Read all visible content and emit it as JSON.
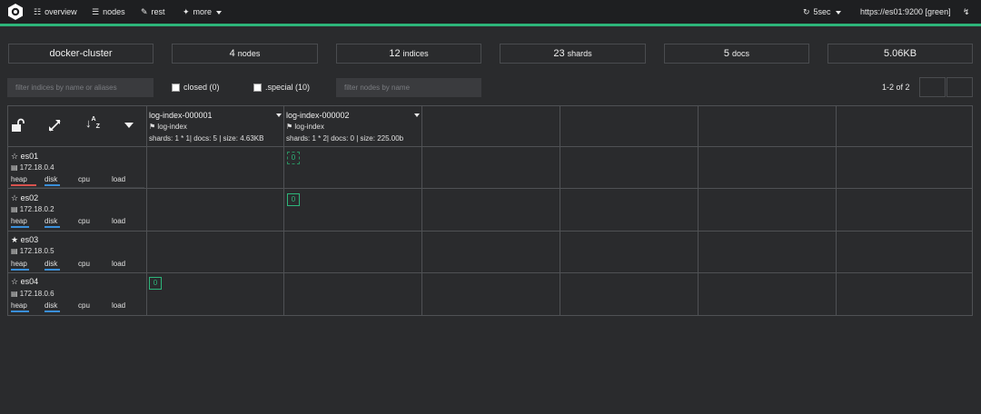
{
  "navbar": {
    "overview": "overview",
    "nodes": "nodes",
    "rest": "rest",
    "more": "more",
    "refresh": "5sec",
    "cluster_url": "https://es01:9200 [green]",
    "accent_color": "#2db57a"
  },
  "stats": {
    "cluster_name": "docker-cluster",
    "nodes_count": "4",
    "nodes_unit": "nodes",
    "indices_count": "12",
    "indices_unit": "indices",
    "shards_count": "23",
    "shards_unit": "shards",
    "docs_count": "5",
    "docs_unit": "docs",
    "size": "5.06KB"
  },
  "filters": {
    "indices_placeholder": "filter indices by name or aliases",
    "closed_label": "closed (0)",
    "special_label": ".special (10)",
    "nodes_placeholder": "filter nodes by name",
    "pagination": "1-2 of 2"
  },
  "indices": [
    {
      "name": "log-index-000001",
      "alias": "log-index",
      "stats": "shards: 1 * 1| docs: 5 | size: 4.63KB"
    },
    {
      "name": "log-index-000002",
      "alias": "log-index",
      "stats": "shards: 1 * 2| docs: 0 | size: 225.00b"
    }
  ],
  "nodes": [
    {
      "name": "es01",
      "ip": "172.18.0.4",
      "master": false,
      "heap_color": "#d9534f",
      "disk_color": "#3a8fd9"
    },
    {
      "name": "es02",
      "ip": "172.18.0.2",
      "master": false,
      "heap_color": "#3a8fd9",
      "disk_color": "#3a8fd9"
    },
    {
      "name": "es03",
      "ip": "172.18.0.5",
      "master": true,
      "heap_color": "#3a8fd9",
      "disk_color": "#3a8fd9"
    },
    {
      "name": "es04",
      "ip": "172.18.0.6",
      "master": false,
      "heap_color": "#3a8fd9",
      "disk_color": "#3a8fd9"
    }
  ],
  "metrics": {
    "heap": "heap",
    "disk": "disk",
    "cpu": "cpu",
    "load": "load"
  },
  "shards": {
    "es01_idx2": "0",
    "es02_idx2": "0",
    "es04_idx1": "0"
  }
}
